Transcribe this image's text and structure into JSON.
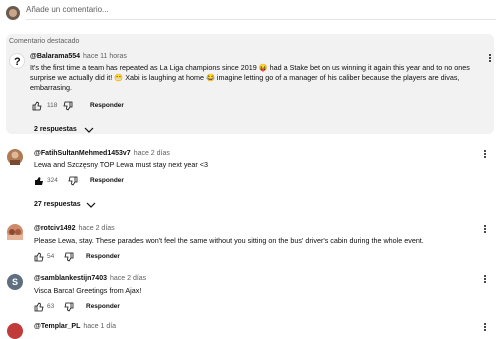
{
  "add_comment": {
    "placeholder": "Añade un comentario..."
  },
  "featured_label": "Comentario destacado",
  "comments": [
    {
      "author": "@Balarama554",
      "time": "hace 11 horas",
      "text_line1": "It's the first time a team has repeated as La Liga champions since 2019 😝 had a Stake bet on us winning it again this year and to no ones",
      "text_line2": "surprise we actually did it! 😁 Xabi is laughing at home 😂 imagine letting go of a manager of his caliber because the players are divas,",
      "text_line3": "embarrasing.",
      "likes": "118",
      "reply_label": "Responder",
      "replies_label": "2 respuestas"
    },
    {
      "author": "@FatihSultanMehmed1453v7",
      "time": "hace 2 días",
      "text_line1": "Lewa and Szczęsny TOP Lewa must stay next year <3",
      "likes": "324",
      "reply_label": "Responder",
      "replies_label": "27 respuestas"
    },
    {
      "author": "@rotciv1492",
      "time": "hace 2 días",
      "text_line1": "Please Lewa, stay. These parades won't feel the same without you sitting on the bus' driver's cabin during the whole event.",
      "likes": "54",
      "reply_label": "Responder"
    },
    {
      "author": "@samblankestijn7403",
      "time": "hace 2 días",
      "avatar_letter": "S",
      "text_line1": "Visca Barca! Greetings from Ajax!",
      "likes": "63",
      "reply_label": "Responder"
    },
    {
      "author": "@Templar_PL",
      "time": "hace 1 día"
    }
  ],
  "colors": {
    "avatar_s": "#5f6f7f",
    "featured_bg": "#f2f2f2"
  }
}
